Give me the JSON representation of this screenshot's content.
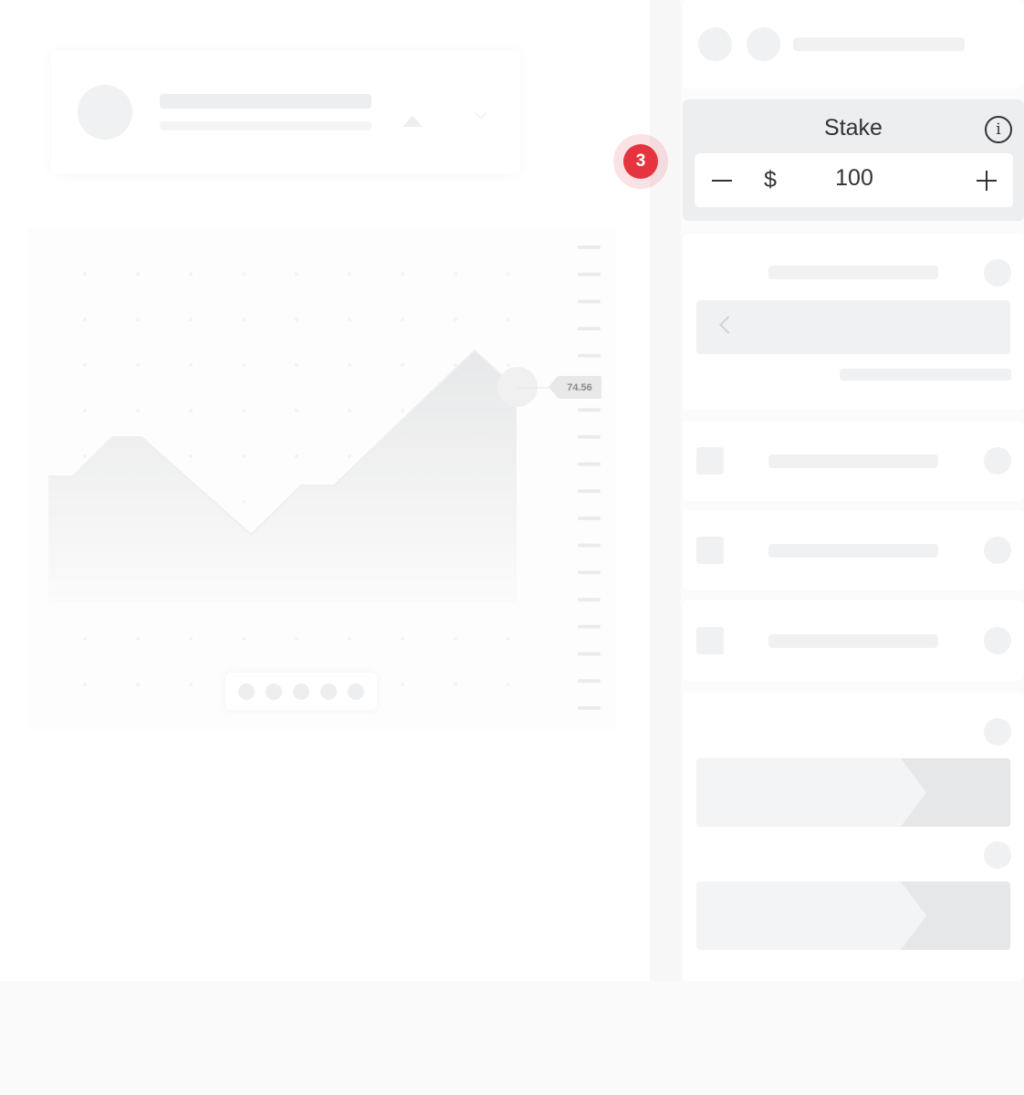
{
  "notification_badge": {
    "count": "3",
    "color": "#e5343f"
  },
  "chart": {
    "current_price": "74.56"
  },
  "stake": {
    "title": "Stake",
    "currency": "$",
    "value": "100",
    "info_icon": "i",
    "icons": {
      "info": "info-icon",
      "decrease": "minus-icon",
      "increase": "plus-icon"
    }
  },
  "colors": {
    "text": "#333333",
    "skeleton": "#f0f1f2",
    "stake_bg": "#eceeef"
  }
}
